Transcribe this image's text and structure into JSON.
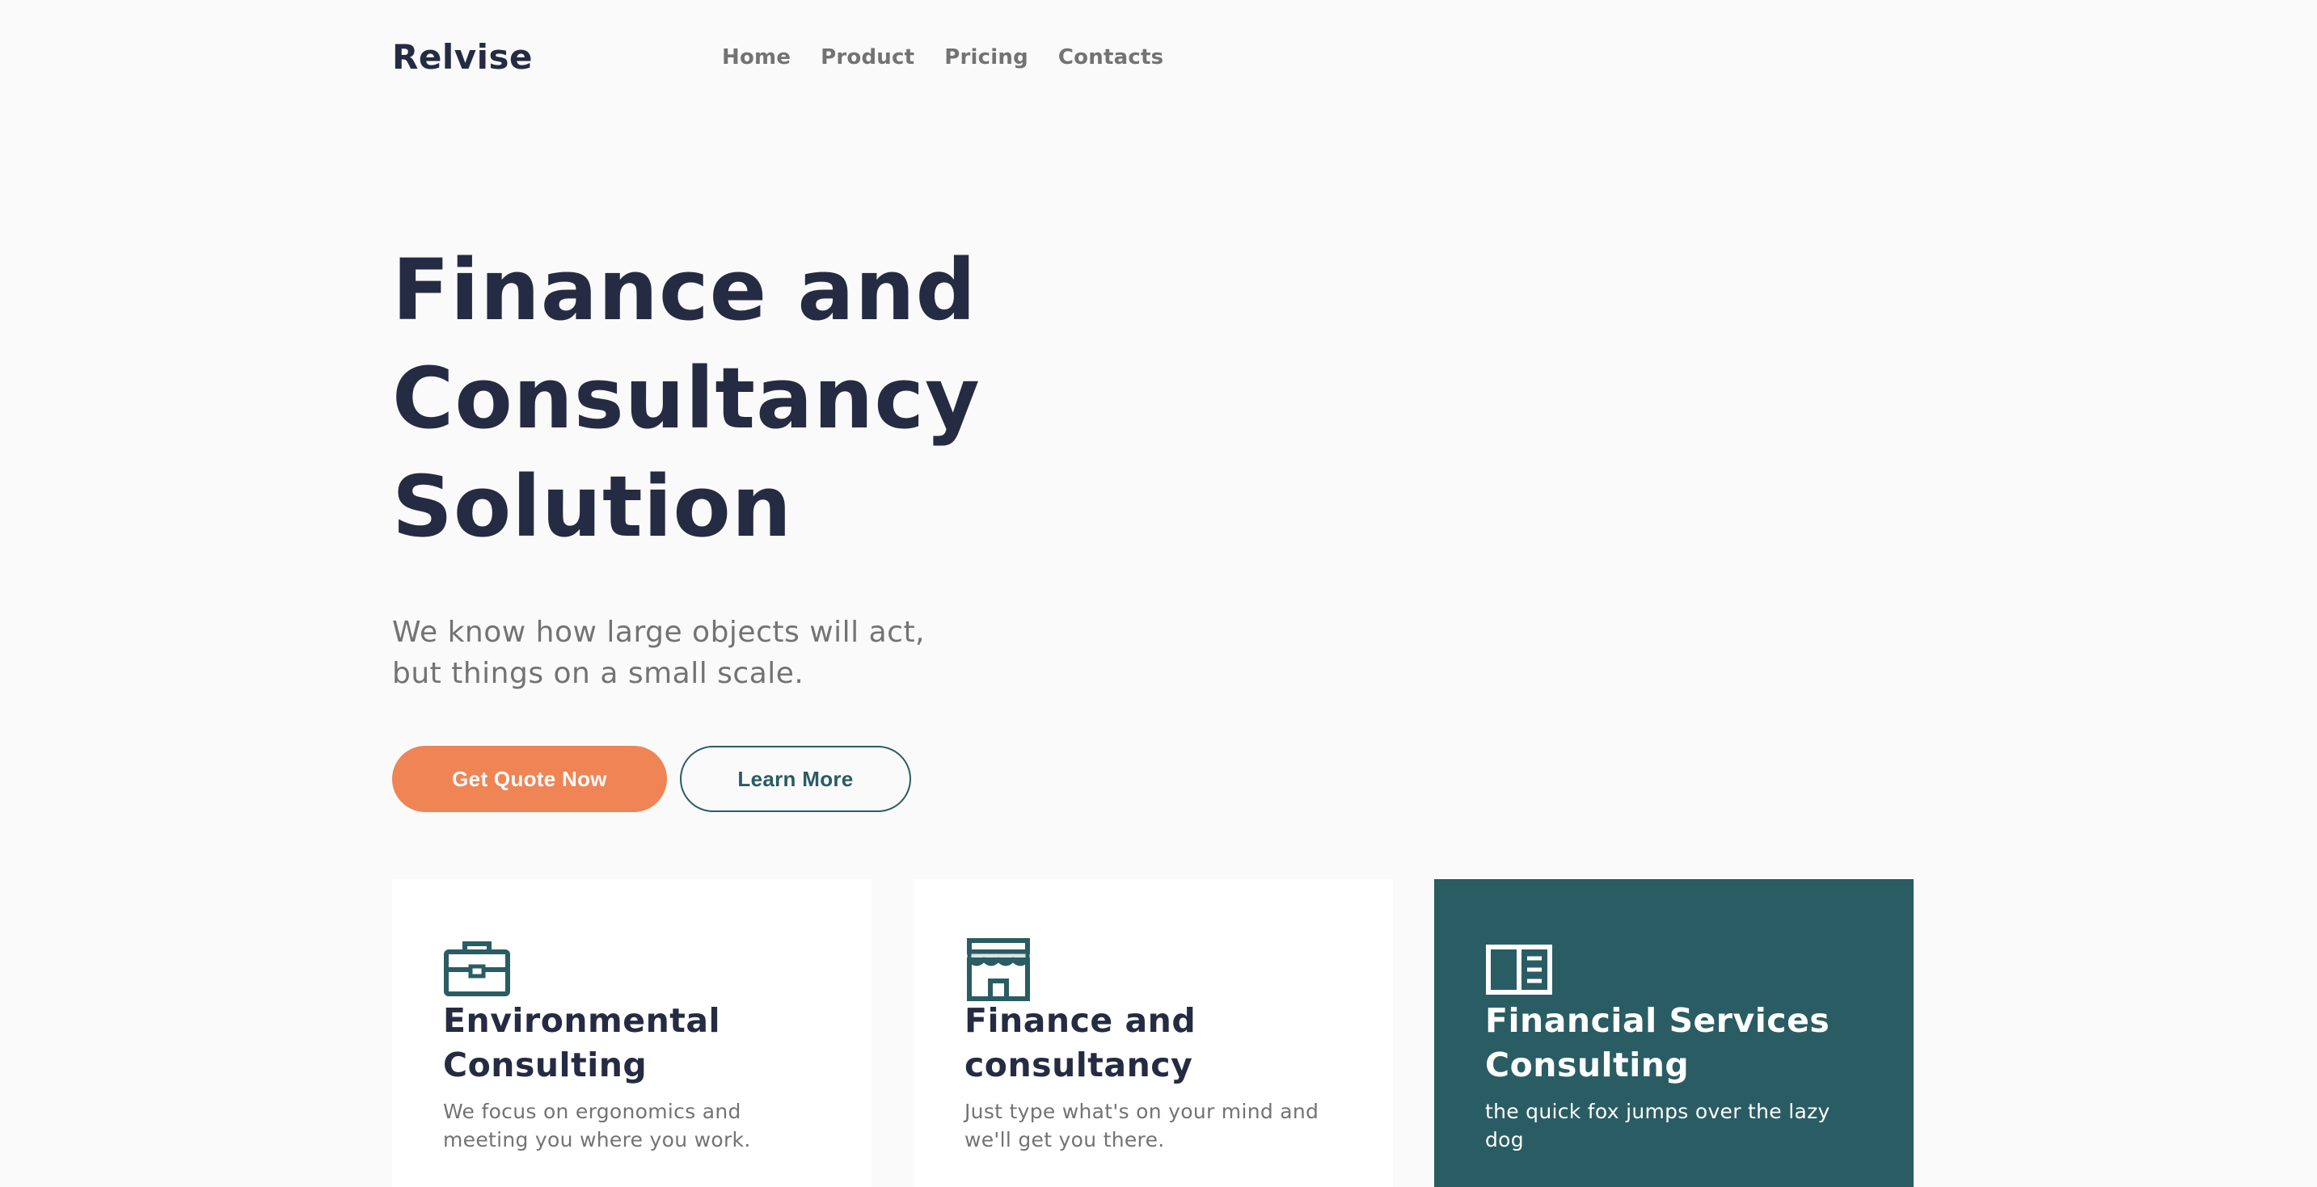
{
  "header": {
    "brand": "Relvise",
    "nav": [
      "Home",
      "Product",
      "Pricing",
      "Contacts"
    ]
  },
  "hero": {
    "title_lines": [
      "Finance and",
      "Consultancy",
      "Solution"
    ],
    "subtitle_lines": [
      "We know how large objects will act,",
      "but things on a small scale."
    ],
    "primary_button": "Get Quote Now",
    "secondary_button": "Learn More"
  },
  "cards": [
    {
      "icon": "briefcase-icon",
      "title_lines": [
        "Environmental",
        "Consulting"
      ],
      "text_lines": [
        "We focus on ergonomics and",
        "meeting you where you work."
      ]
    },
    {
      "icon": "storefront-icon",
      "title_lines": [
        "Finance and",
        "consultancy"
      ],
      "text_lines": [
        "Just type what's on your mind and",
        "we'll get you there."
      ]
    },
    {
      "icon": "book-open-icon",
      "title_lines": [
        "Financial Services",
        "Consulting"
      ],
      "text_lines": [
        "the quick fox jumps over the lazy",
        "dog"
      ]
    }
  ],
  "colors": {
    "background": "#FAFAFA",
    "heading": "#252B42",
    "body_text": "#737373",
    "accent_orange": "#EF8455",
    "accent_teal": "#2A5C63",
    "card_background": "#FFFFFF"
  }
}
